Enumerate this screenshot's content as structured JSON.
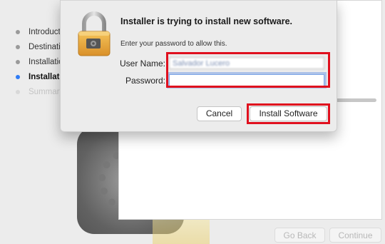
{
  "sidebar": {
    "steps": [
      {
        "label": "Introduction",
        "state": "done"
      },
      {
        "label": "Destination Select",
        "state": "done"
      },
      {
        "label": "Installation Type",
        "state": "done"
      },
      {
        "label": "Installation",
        "state": "active"
      },
      {
        "label": "Summary",
        "state": "disabled"
      }
    ]
  },
  "window": {
    "back_label": "Go Back",
    "continue_label": "Continue"
  },
  "auth_dialog": {
    "icon": "lock-icon",
    "title": "Installer is trying to install new software.",
    "subtitle": "Enter your password to allow this.",
    "username_label": "User Name:",
    "username_value": "Salvador Lucero",
    "password_label": "Password:",
    "password_value": "",
    "cancel_label": "Cancel",
    "install_label": "Install Software"
  },
  "colors": {
    "highlight": "#e0101e",
    "active_step": "#2f7cf6",
    "sheet_background": "#ececec"
  }
}
